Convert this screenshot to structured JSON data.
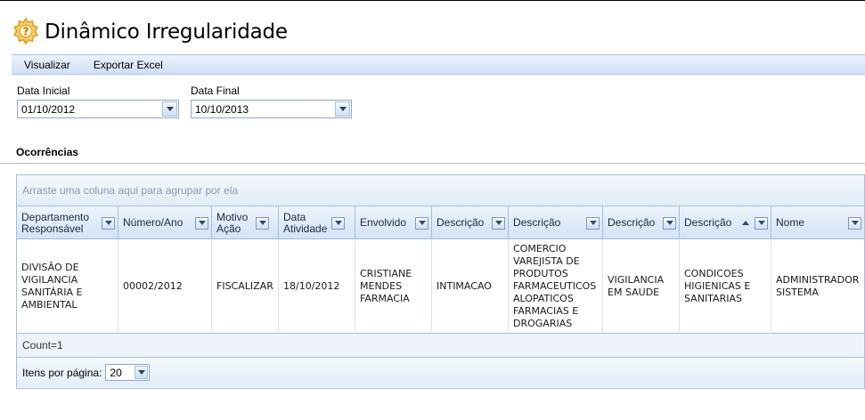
{
  "page": {
    "title": "Dinâmico Irregularidade",
    "icon": "gear-question-icon"
  },
  "menu": {
    "items": [
      "Visualizar",
      "Exportar Excel"
    ]
  },
  "filters": {
    "data_inicial": {
      "label": "Data Inicial",
      "value": "01/10/2012"
    },
    "data_final": {
      "label": "Data Final",
      "value": "10/10/2013"
    }
  },
  "section": {
    "title": "Ocorrências"
  },
  "grid": {
    "group_panel_text": "Arraste uma coluna aqui para agrupar por ela",
    "columns": [
      "Departamento Responsável",
      "Número/Ano",
      "Motivo Ação",
      "Data Atividade",
      "Envolvido",
      "Descrição",
      "Descrição",
      "Descrição",
      "Descrição",
      "Nome"
    ],
    "sorted_column": "Descrição",
    "rows": [
      [
        "DIVISÃO DE VIGILANCIA SANITÁRIA E AMBIENTAL",
        "00002/2012",
        "FISCALIZAR",
        "18/10/2012",
        "CRISTIANE MENDES FARMACIA",
        "INTIMACAO",
        "COMERCIO VAREJISTA DE PRODUTOS FARMACEUTICOS ALOPATICOS FARMACIAS E DROGARIAS",
        "VIGILANCIA EM SAUDE",
        "CONDICOES HIGIENICAS E SANITARIAS",
        "ADMINISTRADOR SISTEMA"
      ]
    ],
    "footer_text": "Count=1",
    "pager": {
      "label": "Itens por página:",
      "value": "20"
    }
  },
  "colors": {
    "accent": "#f5a623",
    "menubar": "#d6e5f7",
    "grid_border": "#a3bedd"
  }
}
